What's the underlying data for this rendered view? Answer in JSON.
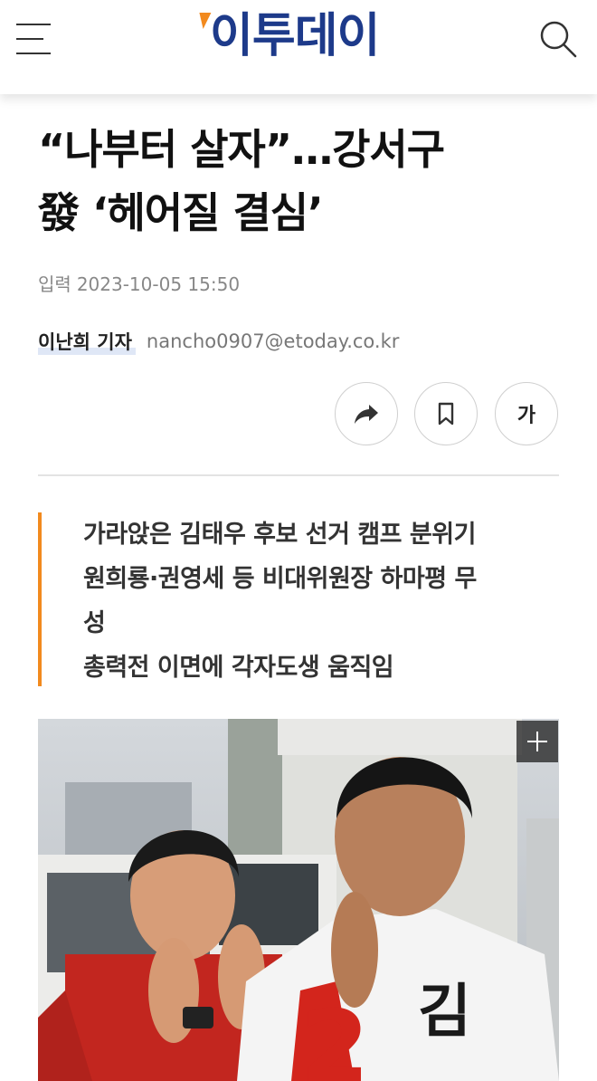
{
  "header": {
    "logo_text": "이투데이",
    "menu_icon": "hamburger-menu-icon",
    "search_icon": "search-icon"
  },
  "article": {
    "headline_line1": "“나부터 살자”…강서구",
    "headline_line2": "發 ‘헤어질 결심’",
    "date_label": "입력",
    "date_value": "2023-10-05 15:50",
    "reporter": "이난희 기자",
    "email": "nancho0907@etoday.co.kr",
    "tools": {
      "share_icon": "share-icon",
      "bookmark_icon": "bookmark-icon",
      "font_size_label": "가"
    },
    "summary": [
      "가라앉은 김태우 후보 선거 캠프 분위기",
      "원희룡·권영세 등 비대위원장 하마평 무",
      "성",
      "총력전 이면에 각자도생 움직임"
    ],
    "photo": {
      "expand_icon": "plus-icon",
      "jacket_text": "2 김"
    }
  },
  "colors": {
    "brand_blue": "#1d3a8a",
    "brand_orange": "#f28a1e",
    "text_dark": "#111111",
    "text_muted": "#888888"
  }
}
